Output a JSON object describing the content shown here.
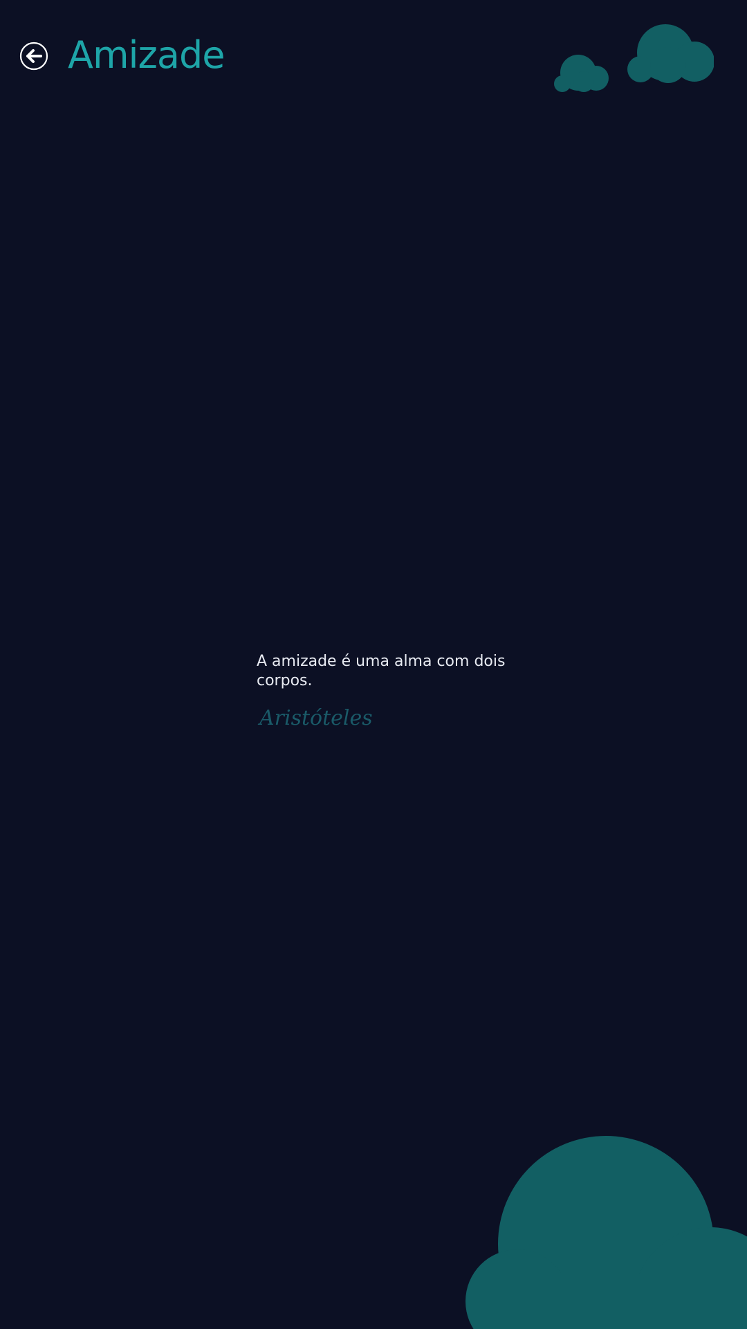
{
  "header": {
    "title": "Amizade",
    "back_icon": "back-arrow-circle-icon"
  },
  "quote": {
    "text": "A amizade é uma alma com dois corpos.",
    "author": "Aristóteles"
  },
  "decorations": {
    "cloud_icon": "cloud-icon"
  },
  "colors": {
    "background": "#0c1024",
    "accent": "#1ea5a8",
    "cloud": "#125f63",
    "quote_text": "#e8ebf2",
    "author": "#1a5a68"
  }
}
